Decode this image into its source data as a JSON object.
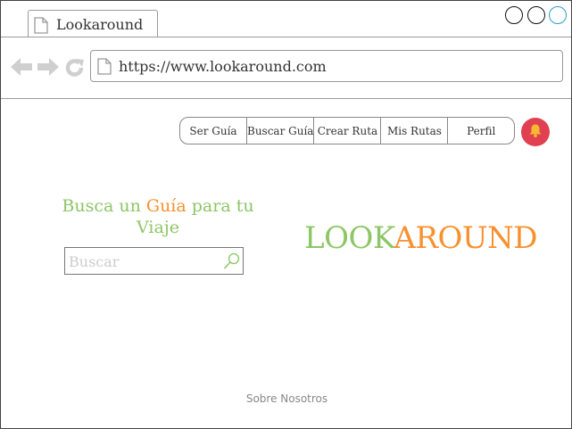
{
  "browser": {
    "tab_title": "Lookaround",
    "url": "https://www.lookaround.com"
  },
  "menu": {
    "items": [
      {
        "label": "Ser Guía"
      },
      {
        "label": "Buscar Guía"
      },
      {
        "label": "Crear Ruta"
      },
      {
        "label": "Mis Rutas"
      },
      {
        "label": "Perfil"
      }
    ]
  },
  "hero": {
    "headline_pre": "Busca un ",
    "headline_accent": "Guía",
    "headline_post": " para tu Viaje",
    "search_placeholder": "Buscar"
  },
  "logo": {
    "part1": "LOOK",
    "part2": "AROUND"
  },
  "footer": {
    "about_label": "Sobre Nosotros"
  },
  "colors": {
    "green": "#8cc665",
    "orange": "#f7912f",
    "bell": "#e0404f"
  },
  "icons": {
    "tab": "document-icon",
    "back": "back-arrow-icon",
    "forward": "forward-arrow-icon",
    "reload": "reload-icon",
    "url": "document-icon",
    "bell": "bell-icon",
    "search": "magnifier-icon"
  }
}
